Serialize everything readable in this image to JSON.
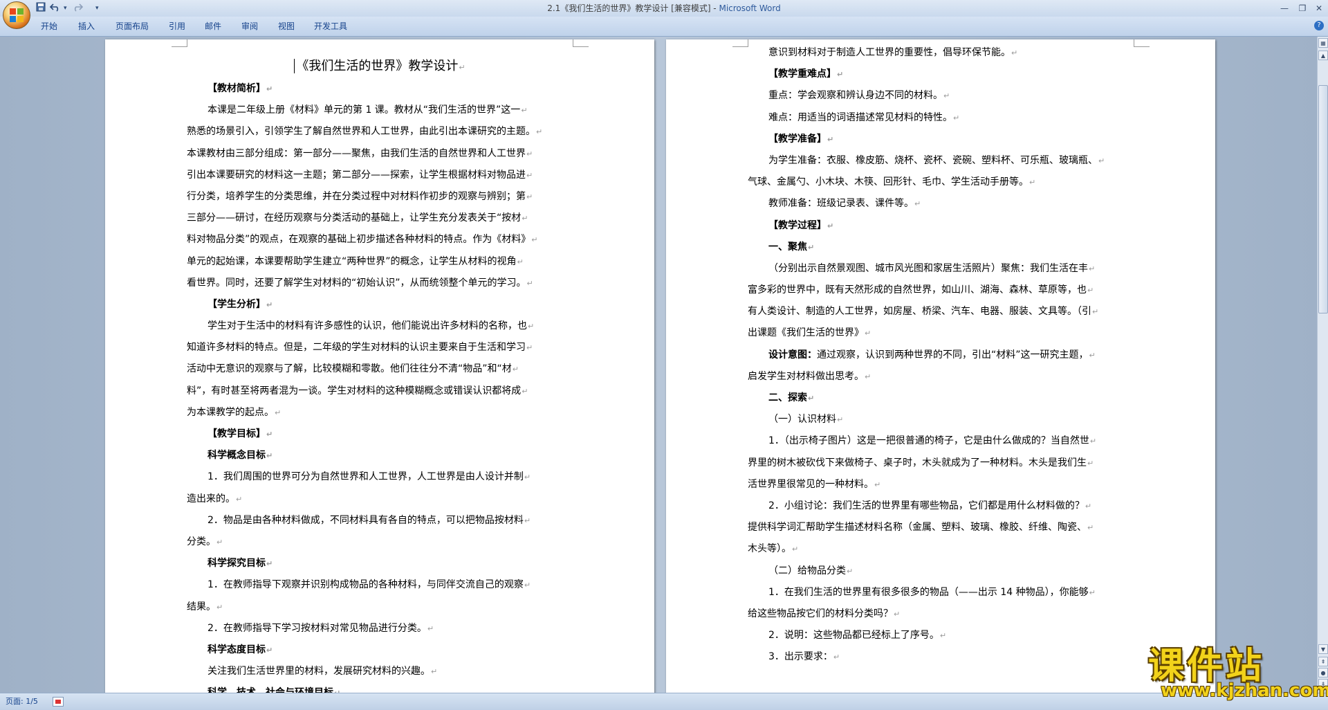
{
  "window": {
    "title": "2.1《我们生活的世界》教学设计 [兼容模式] - ",
    "app_name": "Microsoft Word"
  },
  "quick_access": {
    "save_icon": "save-icon",
    "undo_icon": "undo-icon",
    "redo_icon": "redo-icon",
    "customize_icon": "dropdown-icon"
  },
  "ribbon": {
    "tabs": [
      "开始",
      "插入",
      "页面布局",
      "引用",
      "邮件",
      "审阅",
      "视图",
      "开发工具"
    ]
  },
  "page1": {
    "title": "《我们生活的世界》教学设计",
    "lines": [
      {
        "text": "【教材简析】",
        "style": "ind b"
      },
      {
        "text": "本课是二年级上册《材料》单元的第 1 课。教材从“我们生活的世界”这一",
        "style": "ind"
      },
      {
        "text": "熟悉的场景引入，引领学生了解自然世界和人工世界，由此引出本课研究的主题。",
        "style": ""
      },
      {
        "text": "本课教材由三部分组成：第一部分——聚焦，由我们生活的自然世界和人工世界",
        "style": ""
      },
      {
        "text": "引出本课要研究的材料这一主题；第二部分——探索，让学生根据材料对物品进",
        "style": ""
      },
      {
        "text": "行分类，培养学生的分类思维，并在分类过程中对材料作初步的观察与辨别；第",
        "style": ""
      },
      {
        "text": "三部分——研讨，在经历观察与分类活动的基础上，让学生充分发表关于“按材",
        "style": ""
      },
      {
        "text": "料对物品分类”的观点，在观察的基础上初步描述各种材料的特点。作为《材料》",
        "style": ""
      },
      {
        "text": "单元的起始课，本课要帮助学生建立“两种世界”的概念，让学生从材料的视角",
        "style": ""
      },
      {
        "text": "看世界。同时，还要了解学生对材料的“初始认识”，从而统领整个单元的学习。",
        "style": ""
      },
      {
        "text": "【学生分析】",
        "style": "ind b"
      },
      {
        "text": "学生对于生活中的材料有许多感性的认识，他们能说出许多材料的名称，也",
        "style": "ind"
      },
      {
        "text": "知道许多材料的特点。但是，二年级的学生对材料的认识主要来自于生活和学习",
        "style": ""
      },
      {
        "text": "活动中无意识的观察与了解，比较模糊和零散。他们往往分不清“物品”和“材",
        "style": ""
      },
      {
        "text": "料”，有时甚至将两者混为一谈。学生对材料的这种模糊概念或错误认识都将成",
        "style": ""
      },
      {
        "text": "为本课教学的起点。",
        "style": ""
      },
      {
        "text": "【教学目标】",
        "style": "ind b"
      },
      {
        "text": "科学概念目标",
        "style": "ind b"
      },
      {
        "text": "1．我们周围的世界可分为自然世界和人工世界，人工世界是由人设计并制",
        "style": "ind"
      },
      {
        "text": "造出来的。",
        "style": ""
      },
      {
        "text": "2．物品是由各种材料做成，不同材料具有各自的特点，可以把物品按材料",
        "style": "ind"
      },
      {
        "text": "分类。",
        "style": ""
      },
      {
        "text": "科学探究目标",
        "style": "ind b"
      },
      {
        "text": "1．在教师指导下观察并识别构成物品的各种材料，与同伴交流自己的观察",
        "style": "ind"
      },
      {
        "text": "结果。",
        "style": ""
      },
      {
        "text": "2．在教师指导下学习按材料对常见物品进行分类。",
        "style": "ind"
      },
      {
        "text": "科学态度目标",
        "style": "ind b"
      },
      {
        "text": "关注我们生活世界里的材料，发展研究材料的兴趣。",
        "style": "ind"
      },
      {
        "text": "科学、技术、社会与环境目标",
        "style": "ind b"
      }
    ]
  },
  "page2": {
    "lines": [
      {
        "text": "意识到材料对于制造人工世界的重要性，倡导环保节能。",
        "style": "ind"
      },
      {
        "text": "【教学重难点】",
        "style": "ind b"
      },
      {
        "text": "重点：学会观察和辨认身边不同的材料。",
        "style": "ind"
      },
      {
        "text": "难点：用适当的词语描述常见材料的特性。",
        "style": "ind"
      },
      {
        "text": "【教学准备】",
        "style": "ind b"
      },
      {
        "text": "为学生准备：衣服、橡皮筋、烧杯、瓷杯、瓷碗、塑料杯、可乐瓶、玻璃瓶、",
        "style": "ind"
      },
      {
        "text": "气球、金属勺、小木块、木筷、回形针、毛巾、学生活动手册等。",
        "style": ""
      },
      {
        "text": "教师准备：班级记录表、课件等。",
        "style": "ind"
      },
      {
        "text": "【教学过程】",
        "style": "ind b"
      },
      {
        "text": "一、聚焦",
        "style": "ind b"
      },
      {
        "text": "（分别出示自然景观图、城市风光图和家居生活照片）聚焦：我们生活在丰",
        "style": "ind"
      },
      {
        "text": "富多彩的世界中，既有天然形成的自然世界，如山川、湖海、森林、草原等，也",
        "style": ""
      },
      {
        "text": "有人类设计、制造的人工世界，如房屋、桥梁、汽车、电器、服装、文具等。（引",
        "style": ""
      },
      {
        "text": "出课题《我们生活的世界》",
        "style": ""
      },
      {
        "text": "设计意图：通过观察，认识到两种世界的不同，引出“材料”这一研究主题，",
        "style": "ind",
        "bold_prefix": "设计意图："
      },
      {
        "text": "启发学生对材料做出思考。",
        "style": ""
      },
      {
        "text": "二、探索",
        "style": "ind b"
      },
      {
        "text": "（一）认识材料",
        "style": "ind"
      },
      {
        "text": "1．（出示椅子图片）这是一把很普通的椅子，它是由什么做成的？当自然世",
        "style": "ind"
      },
      {
        "text": "界里的树木被砍伐下来做椅子、桌子时，木头就成为了一种材料。木头是我们生",
        "style": ""
      },
      {
        "text": "活世界里很常见的一种材料。",
        "style": ""
      },
      {
        "text": "2．小组讨论：我们生活的世界里有哪些物品，它们都是用什么材料做的？",
        "style": "ind"
      },
      {
        "text": "提供科学词汇帮助学生描述材料名称（金属、塑料、玻璃、橡胶、纤维、陶瓷、",
        "style": ""
      },
      {
        "text": "木头等）。",
        "style": ""
      },
      {
        "text": "（二）给物品分类",
        "style": "ind"
      },
      {
        "text": "1．在我们生活的世界里有很多很多的物品（——出示 14 种物品），你能够",
        "style": "ind"
      },
      {
        "text": "给这些物品按它们的材料分类吗？",
        "style": ""
      },
      {
        "text": "2．说明：这些物品都已经标上了序号。",
        "style": "ind"
      },
      {
        "text": "3．出示要求：",
        "style": "ind"
      }
    ]
  },
  "paragraph_mark": "↵",
  "status": {
    "page": "页面: 1/5"
  },
  "watermark": {
    "title": "课件站",
    "url": "www.kjzhan.com"
  }
}
